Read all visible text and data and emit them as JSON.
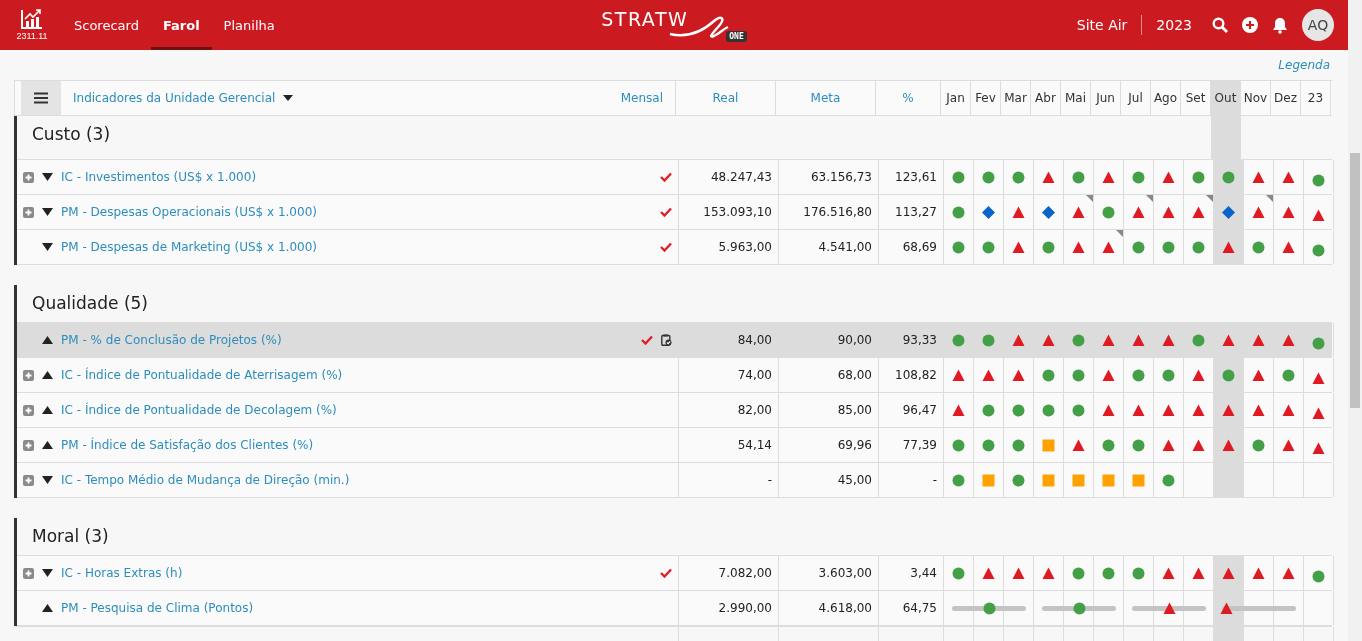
{
  "app": {
    "version": "2311.11",
    "tabs": [
      {
        "label": "Scorecard",
        "selected": false
      },
      {
        "label": "Farol",
        "selected": true
      },
      {
        "label": "Planilha",
        "selected": false
      }
    ],
    "brand": "STRATW",
    "brand_badge": "ONE",
    "site": "Site Air",
    "year": "2023",
    "avatar": "AQ"
  },
  "legend_link": "Legenda",
  "table": {
    "view": "Indicadores da Unidade Gerencial",
    "period": "Mensal",
    "columns": [
      "Real",
      "Meta",
      "%"
    ],
    "months": [
      {
        "label": "Jan",
        "selected": false
      },
      {
        "label": "Fev",
        "selected": false
      },
      {
        "label": "Mar",
        "selected": false
      },
      {
        "label": "Abr",
        "selected": false
      },
      {
        "label": "Mai",
        "selected": false
      },
      {
        "label": "Jun",
        "selected": false
      },
      {
        "label": "Jul",
        "selected": false
      },
      {
        "label": "Ago",
        "selected": false
      },
      {
        "label": "Set",
        "selected": false
      },
      {
        "label": "Out",
        "selected": true
      },
      {
        "label": "Nov",
        "selected": false
      },
      {
        "label": "Dez",
        "selected": false
      }
    ],
    "year_column": "23",
    "groups": [
      {
        "title": "Custo (3)",
        "rows": [
          {
            "kind": "monthly",
            "expandable": true,
            "rising": false,
            "name": "IC - Investimentos (US$ x 1.000)",
            "checked": true,
            "attachment": false,
            "selected": false,
            "real": "48.247,43",
            "meta": "63.156,73",
            "pct": "123,61",
            "months": [
              {
                "kind": "circle",
                "note": false
              },
              {
                "kind": "circle",
                "note": false
              },
              {
                "kind": "circle",
                "note": false
              },
              {
                "kind": "triangle",
                "note": false
              },
              {
                "kind": "circle",
                "note": false
              },
              {
                "kind": "triangle",
                "note": false
              },
              {
                "kind": "circle",
                "note": false
              },
              {
                "kind": "triangle",
                "note": false
              },
              {
                "kind": "circle",
                "note": false
              },
              {
                "kind": "circle",
                "note": false
              },
              {
                "kind": "triangle",
                "note": false
              },
              {
                "kind": "triangle",
                "note": false
              }
            ],
            "year_status": {
              "kind": "circle"
            }
          },
          {
            "kind": "monthly",
            "expandable": true,
            "rising": false,
            "name": "PM - Despesas Operacionais (US$ x 1.000)",
            "checked": true,
            "attachment": false,
            "selected": false,
            "real": "153.093,10",
            "meta": "176.516,80",
            "pct": "113,27",
            "months": [
              {
                "kind": "circle",
                "note": false
              },
              {
                "kind": "diamond",
                "note": false
              },
              {
                "kind": "triangle",
                "note": false
              },
              {
                "kind": "diamond",
                "note": false
              },
              {
                "kind": "triangle",
                "note": true
              },
              {
                "kind": "circle",
                "note": false
              },
              {
                "kind": "triangle",
                "note": true
              },
              {
                "kind": "triangle",
                "note": false
              },
              {
                "kind": "triangle",
                "note": true
              },
              {
                "kind": "diamond",
                "note": false
              },
              {
                "kind": "triangle",
                "note": true
              },
              {
                "kind": "triangle",
                "note": false
              }
            ],
            "year_status": {
              "kind": "triangle"
            }
          },
          {
            "kind": "monthly",
            "expandable": false,
            "rising": false,
            "name": "PM - Despesas de Marketing (US$ x 1.000)",
            "checked": true,
            "attachment": false,
            "selected": false,
            "real": "5.963,00",
            "meta": "4.541,00",
            "pct": "68,69",
            "months": [
              {
                "kind": "circle",
                "note": false
              },
              {
                "kind": "circle",
                "note": false
              },
              {
                "kind": "triangle",
                "note": false
              },
              {
                "kind": "circle",
                "note": false
              },
              {
                "kind": "triangle",
                "note": false
              },
              {
                "kind": "triangle",
                "note": true
              },
              {
                "kind": "circle",
                "note": false
              },
              {
                "kind": "circle",
                "note": false
              },
              {
                "kind": "circle",
                "note": false
              },
              {
                "kind": "triangle",
                "note": false
              },
              {
                "kind": "circle",
                "note": false
              },
              {
                "kind": "triangle",
                "note": false
              }
            ],
            "year_status": {
              "kind": "circle"
            }
          }
        ]
      },
      {
        "title": "Qualidade (5)",
        "rows": [
          {
            "kind": "monthly",
            "expandable": false,
            "rising": true,
            "name": "PM - % de Conclusão de Projetos (%)",
            "checked": true,
            "attachment": true,
            "selected": true,
            "real": "84,00",
            "meta": "90,00",
            "pct": "93,33",
            "months": [
              {
                "kind": "circle",
                "note": false
              },
              {
                "kind": "circle",
                "note": false
              },
              {
                "kind": "triangle",
                "note": false
              },
              {
                "kind": "triangle",
                "note": false
              },
              {
                "kind": "circle",
                "note": false
              },
              {
                "kind": "triangle",
                "note": false
              },
              {
                "kind": "triangle",
                "note": false
              },
              {
                "kind": "triangle",
                "note": false
              },
              {
                "kind": "circle",
                "note": false
              },
              {
                "kind": "triangle",
                "note": false
              },
              {
                "kind": "triangle",
                "note": false
              },
              {
                "kind": "triangle",
                "note": false
              }
            ],
            "year_status": {
              "kind": "circle"
            }
          },
          {
            "kind": "monthly",
            "expandable": true,
            "rising": true,
            "name": "IC - Índice de Pontualidade de Aterrisagem (%)",
            "checked": false,
            "attachment": false,
            "selected": false,
            "real": "74,00",
            "meta": "68,00",
            "pct": "108,82",
            "months": [
              {
                "kind": "triangle",
                "note": false
              },
              {
                "kind": "triangle",
                "note": false
              },
              {
                "kind": "triangle",
                "note": false
              },
              {
                "kind": "circle",
                "note": false
              },
              {
                "kind": "circle",
                "note": false
              },
              {
                "kind": "triangle",
                "note": false
              },
              {
                "kind": "circle",
                "note": false
              },
              {
                "kind": "circle",
                "note": false
              },
              {
                "kind": "triangle",
                "note": false
              },
              {
                "kind": "circle",
                "note": false
              },
              {
                "kind": "triangle",
                "note": false
              },
              {
                "kind": "circle",
                "note": false
              }
            ],
            "year_status": {
              "kind": "triangle"
            }
          },
          {
            "kind": "monthly",
            "expandable": true,
            "rising": true,
            "name": "IC - Índice de Pontualidade de Decolagem (%)",
            "checked": false,
            "attachment": false,
            "selected": false,
            "real": "82,00",
            "meta": "85,00",
            "pct": "96,47",
            "months": [
              {
                "kind": "triangle",
                "note": false
              },
              {
                "kind": "circle",
                "note": false
              },
              {
                "kind": "circle",
                "note": false
              },
              {
                "kind": "circle",
                "note": false
              },
              {
                "kind": "circle",
                "note": false
              },
              {
                "kind": "triangle",
                "note": false
              },
              {
                "kind": "triangle",
                "note": false
              },
              {
                "kind": "triangle",
                "note": false
              },
              {
                "kind": "triangle",
                "note": false
              },
              {
                "kind": "triangle",
                "note": false
              },
              {
                "kind": "triangle",
                "note": false
              },
              {
                "kind": "triangle",
                "note": false
              }
            ],
            "year_status": {
              "kind": "triangle"
            }
          },
          {
            "kind": "monthly",
            "expandable": true,
            "rising": true,
            "name": "PM - Índice de Satisfação dos Clientes (%)",
            "checked": false,
            "attachment": false,
            "selected": false,
            "real": "54,14",
            "meta": "69,96",
            "pct": "77,39",
            "months": [
              {
                "kind": "circle",
                "note": false
              },
              {
                "kind": "circle",
                "note": false
              },
              {
                "kind": "circle",
                "note": false
              },
              {
                "kind": "square",
                "note": false
              },
              {
                "kind": "triangle",
                "note": false
              },
              {
                "kind": "circle",
                "note": false
              },
              {
                "kind": "circle",
                "note": false
              },
              {
                "kind": "triangle",
                "note": false
              },
              {
                "kind": "triangle",
                "note": false
              },
              {
                "kind": "triangle",
                "note": false
              },
              {
                "kind": "circle",
                "note": false
              },
              {
                "kind": "triangle",
                "note": false
              }
            ],
            "year_status": {
              "kind": "triangle"
            }
          },
          {
            "kind": "monthly",
            "expandable": true,
            "rising": false,
            "name": "IC - Tempo Médio de Mudança de Direção (min.)",
            "checked": false,
            "attachment": false,
            "selected": false,
            "real": "-",
            "meta": "45,00",
            "pct": "-",
            "months": [
              {
                "kind": "circle",
                "note": false
              },
              {
                "kind": "square",
                "note": false
              },
              {
                "kind": "circle",
                "note": false
              },
              {
                "kind": "square",
                "note": false
              },
              {
                "kind": "square",
                "note": false
              },
              {
                "kind": "square",
                "note": false
              },
              {
                "kind": "square",
                "note": false
              },
              {
                "kind": "circle",
                "note": false
              },
              {
                "kind": "empty",
                "note": false
              },
              {
                "kind": "empty",
                "note": false
              },
              {
                "kind": "empty",
                "note": false
              },
              {
                "kind": "empty",
                "note": false
              }
            ],
            "year_status": {
              "kind": "empty"
            }
          }
        ]
      },
      {
        "title": "Moral (3)",
        "rows": [
          {
            "kind": "monthly",
            "expandable": true,
            "rising": false,
            "name": "IC - Horas Extras (h)",
            "checked": true,
            "attachment": false,
            "selected": false,
            "real": "7.082,00",
            "meta": "3.603,00",
            "pct": "3,44",
            "months": [
              {
                "kind": "circle",
                "note": false
              },
              {
                "kind": "triangle",
                "note": false
              },
              {
                "kind": "triangle",
                "note": false
              },
              {
                "kind": "triangle",
                "note": false
              },
              {
                "kind": "circle",
                "note": false
              },
              {
                "kind": "circle",
                "note": false
              },
              {
                "kind": "circle",
                "note": false
              },
              {
                "kind": "triangle",
                "note": false
              },
              {
                "kind": "triangle",
                "note": false
              },
              {
                "kind": "triangle",
                "note": false
              },
              {
                "kind": "triangle",
                "note": false
              },
              {
                "kind": "triangle",
                "note": false
              }
            ],
            "year_status": {
              "kind": "circle"
            }
          },
          {
            "kind": "quarterly",
            "expandable": false,
            "rising": true,
            "name": "PM - Pesquisa de Clima (Pontos)",
            "checked": false,
            "attachment": false,
            "selected": false,
            "real": "2.990,00",
            "meta": "4.618,00",
            "pct": "64,75",
            "quarters": [
              {
                "kind": "circle",
                "level": 0.5
              },
              {
                "kind": "circle",
                "level": 0.5
              },
              {
                "kind": "triangle",
                "level": 0.5
              },
              {
                "kind": "triangle",
                "level": 0.05
              }
            ],
            "year_status": {
              "kind": "empty"
            }
          }
        ]
      }
    ]
  }
}
